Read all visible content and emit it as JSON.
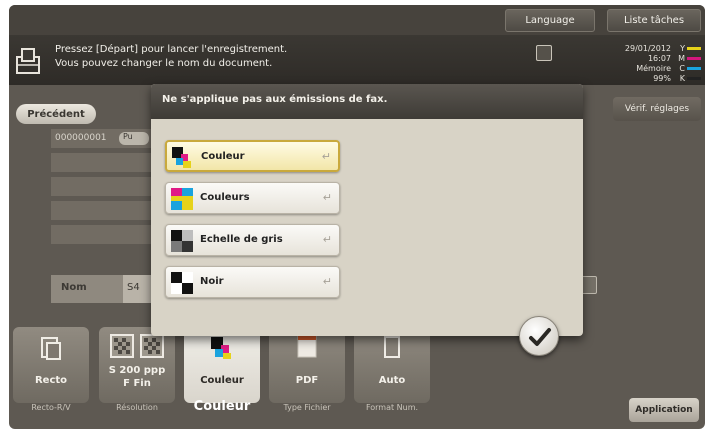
{
  "topbar": {
    "language_label": "Language",
    "job_list_label": "Liste tâches"
  },
  "message": {
    "line1": "Pressez [Départ] pour lancer l'enregistrement.",
    "line2": "Vous pouvez changer le nom du document."
  },
  "status": {
    "date": "29/01/2012",
    "time": "16:07",
    "memory_label": "Mémoire",
    "memory_value": "99%",
    "toner_letters": [
      "Y",
      "M",
      "C",
      "K"
    ],
    "toner_colors": {
      "Y": "#e6d21a",
      "M": "#d4177e",
      "C": "#1aa3de",
      "K": "#222222"
    }
  },
  "buttons": {
    "verif_label": "Vérif. réglages",
    "previous_label": "Précédent",
    "application_label": "Application"
  },
  "background_list": {
    "first_row_number": "000000001",
    "first_row_tag": "Pu",
    "name_label": "Nom",
    "name_value": "S4"
  },
  "dialog": {
    "title": "Ne s'applique pas aux émissions de fax.",
    "options": [
      {
        "label": "Couleur",
        "selected": true,
        "icon": "color-swatch-icon"
      },
      {
        "label": "Couleurs",
        "selected": false,
        "icon": "multicolor-swatch-icon"
      },
      {
        "label": "Echelle de gris",
        "selected": false,
        "icon": "grayscale-swatch-icon"
      },
      {
        "label": "Noir",
        "selected": false,
        "icon": "black-swatch-icon"
      }
    ],
    "enter_glyph": "↵",
    "ok_glyph": "✔"
  },
  "tabs": [
    {
      "label": "Recto",
      "sublabel": "Recto-R/V",
      "icon": "simplex-page-icon",
      "active": false
    },
    {
      "label_line1": "S 200 ppp",
      "label_line2": "F Fin",
      "sublabel": "Résolution",
      "icon": "resolution-icon",
      "active": false
    },
    {
      "label": "Couleur",
      "sublabel": "Couleur",
      "icon": "color-mode-icon",
      "active": true
    },
    {
      "label": "PDF",
      "sublabel": "Type Fichier",
      "icon": "pdf-file-icon",
      "active": false
    },
    {
      "label": "Auto",
      "sublabel": "Format Num.",
      "icon": "scan-size-icon",
      "active": false
    }
  ],
  "colors": {
    "accent_yellow": "#c9a93c",
    "panel": "#5e5952",
    "dialog": "#d8d3c6"
  }
}
